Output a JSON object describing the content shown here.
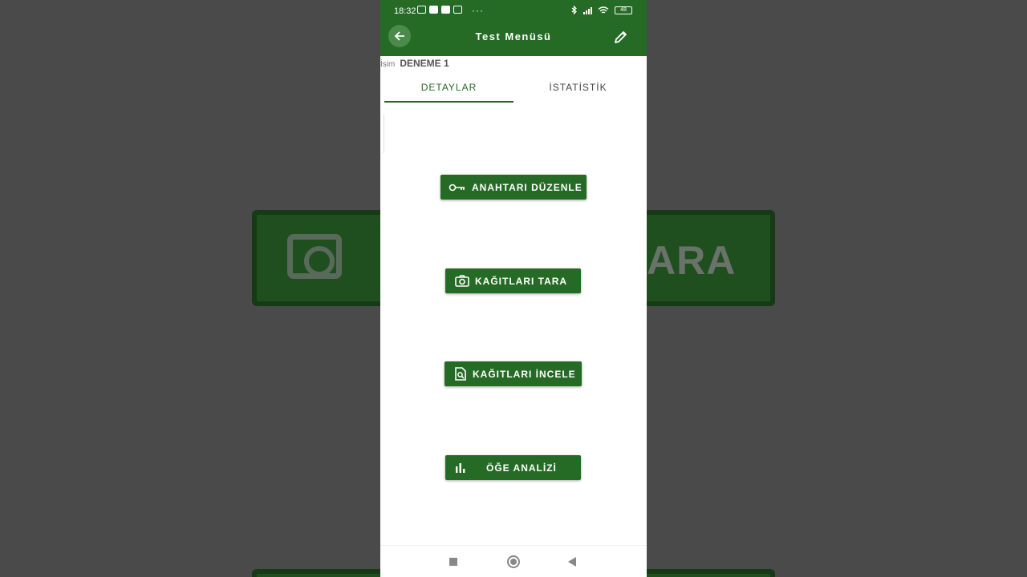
{
  "status_bar": {
    "time": "18:32",
    "battery": "48"
  },
  "app_bar": {
    "title": "Test Menüsü"
  },
  "name_field": {
    "label": "İsim",
    "value": "DENEME 1"
  },
  "tabs": [
    {
      "label": "DETAYLAR",
      "active": true
    },
    {
      "label": "İSTATİSTİK",
      "active": false
    }
  ],
  "actions": {
    "edit_key": "ANAHTARI DÜZENLE",
    "scan_papers": "KAĞITLARI TARA",
    "review_papers": "KAĞITLARI İNCELE",
    "item_analysis": "ÖĞE ANALİZİ"
  },
  "background": {
    "blurred_text": "ARA"
  },
  "colors": {
    "primary": "#256b25",
    "background": "#4a4a4a"
  },
  "icons": [
    "back-arrow-icon",
    "pencil-icon",
    "key-icon",
    "camera-icon",
    "document-search-icon",
    "bar-chart-icon"
  ]
}
